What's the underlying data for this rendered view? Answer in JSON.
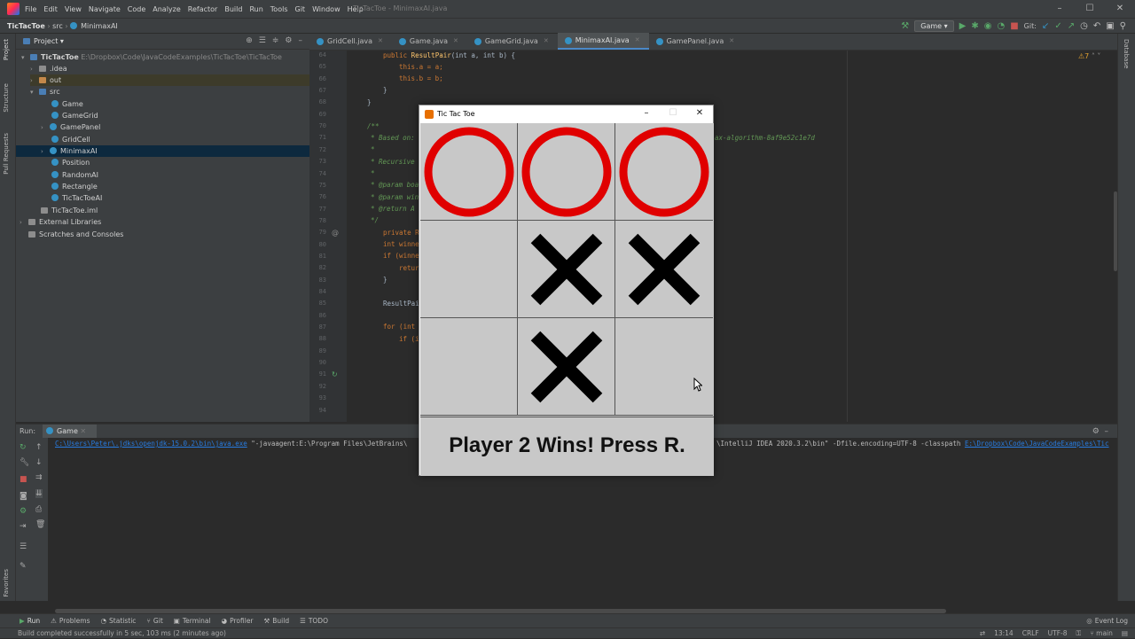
{
  "menu": [
    "File",
    "Edit",
    "View",
    "Navigate",
    "Code",
    "Analyze",
    "Refactor",
    "Build",
    "Run",
    "Tools",
    "Git",
    "Window",
    "Help"
  ],
  "window_title": "TicTacToe - MinimaxAI.java",
  "nav": {
    "project": "TicTacToe",
    "folder": "src",
    "file": "MinimaxAI",
    "run_config": "Game",
    "git_label": "Git:"
  },
  "project_panel": {
    "title": "Project",
    "root": "TicTacToe",
    "root_path": "E:\\Dropbox\\Code\\JavaCodeExamples\\TicTacToe\\TicTacToe",
    "items": [
      ".idea",
      "out",
      "src",
      "Game",
      "GameGrid",
      "GamePanel",
      "GridCell",
      "MinimaxAI",
      "Position",
      "RandomAI",
      "Rectangle",
      "TicTacToeAI",
      "TicTacToe.iml",
      "External Libraries",
      "Scratches and Consoles"
    ]
  },
  "side_labels": {
    "project": "Project",
    "structure": "Structure",
    "pull_requests": "Pull Requests",
    "favorites": "Favorites",
    "database": "Database"
  },
  "tabs": [
    "GridCell.java",
    "Game.java",
    "GameGrid.java",
    "MinimaxAI.java",
    "GamePanel.java"
  ],
  "warnings": "7",
  "code": {
    "line_numbers": [
      "64",
      "65",
      "66",
      "67",
      "68",
      "69",
      "70",
      "71",
      "72",
      "73",
      "74",
      "75",
      "76",
      "77",
      "78",
      "79",
      "80",
      "81",
      "82",
      "83",
      "84",
      "85",
      "86",
      "87",
      "88",
      "89",
      "90",
      "91",
      "92",
      "93",
      "94"
    ],
    "l64_kw": "public ",
    "l64_fn": "ResultPair",
    "l64_rest": "(int a, int b) {",
    "l65": "this.a = a;",
    "l66": "this.b = b;",
    "l67": "}",
    "l68": "}",
    "l70": "/**",
    "l71": "* Based on:",
    "l71_tail": "ax-algorithm-8af9e52c1e7d",
    "l72": "*",
    "l73": "* Recursive",
    "l74": "*",
    "l75": "* @param boa",
    "l76": "* @param win",
    "l77": "* @return A",
    "l78": "*/",
    "l79": "private R",
    "l80": "int winne",
    "l81": "if (winne",
    "l82": "retur",
    "l83": "}",
    "l85": "ResultPai",
    "l87": "for (int",
    "l88": "if (i"
  },
  "run": {
    "label": "Run:",
    "tab": "Game",
    "cmd_link": "C:\\Users\\Peter\\.jdks\\openjdk-15.0.2\\bin\\java.exe",
    "cmd_mid": " \"-javaagent:E:\\Program Files\\JetBrains\\",
    "cmd_right": "\\IntelliJ IDEA 2020.3.2\\bin\" -Dfile.encoding=UTF-8 -classpath ",
    "cmd_right_link": "E:\\Dropbox\\Code\\JavaCodeExamples\\Tic"
  },
  "bottom_tabs": [
    "Run",
    "Problems",
    "Statistic",
    "Git",
    "Terminal",
    "Profiler",
    "Build",
    "TODO"
  ],
  "event_log": "Event Log",
  "status": {
    "message": "Build completed successfully in 5 sec, 103 ms (2 minutes ago)",
    "position": "13:14",
    "line_sep": "CRLF",
    "encoding": "UTF-8",
    "branch": "main"
  },
  "game": {
    "title": "Tic Tac Toe",
    "board": [
      "O",
      "O",
      "O",
      "",
      "X",
      "X",
      "",
      "X",
      ""
    ],
    "message": "Player 2 Wins! Press R.",
    "o_color": "#e00000",
    "x_color": "#000000",
    "board_bg": "#c8c8c8"
  }
}
